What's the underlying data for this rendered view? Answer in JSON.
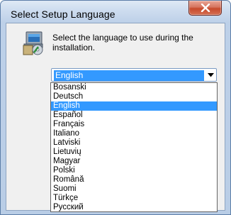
{
  "window": {
    "title": "Select Setup Language",
    "close_icon": "close-icon"
  },
  "dialog": {
    "icon": "setup-computer-icon",
    "prompt": "Select the language to use during the installation."
  },
  "language_select": {
    "selected": "English",
    "arrow_icon": "chevron-down-icon",
    "options": [
      "Bosanski",
      "Deutsch",
      "English",
      "Español",
      "Français",
      "Italiano",
      "Latviski",
      "Lietuvių",
      "Magyar",
      "Polski",
      "Română",
      "Suomi",
      "Türkçe",
      "Русский"
    ],
    "selected_index": 2
  },
  "colors": {
    "selection": "#3399ff",
    "close_button": "#c74a2c"
  }
}
